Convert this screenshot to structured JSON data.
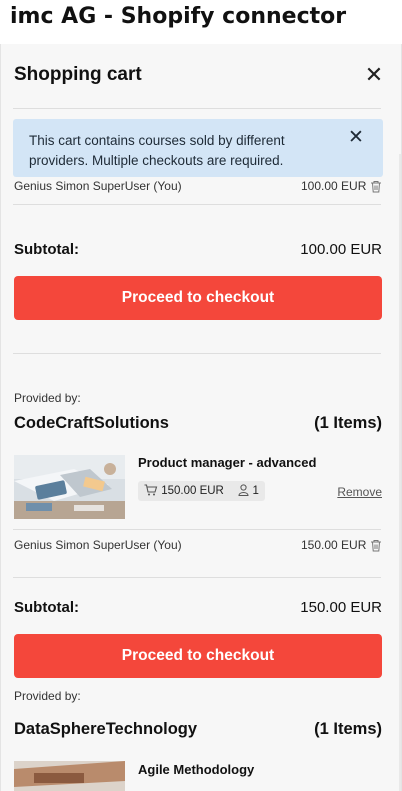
{
  "page_heading": "imc AG - Shopify connector",
  "cart": {
    "title": "Shopping cart",
    "close_icon": "close-icon",
    "notice": {
      "text": "This cart contains courses sold by different providers. Multiple checkouts are required.",
      "close_icon": "close-icon"
    },
    "first_group_partial": {
      "participant": "Genius Simon SuperUser (You)",
      "price": "100.00 EUR",
      "subtotal_label": "Subtotal:",
      "subtotal_value": "100.00 EUR",
      "checkout_label": "Proceed to checkout"
    },
    "groups": [
      {
        "provided_by": "Provided by:",
        "provider": "CodeCraftSolutions",
        "count": "(1 Items)",
        "item": {
          "title": "Product manager - advanced",
          "price": "150.00 EUR",
          "seats": "1",
          "remove_label": "Remove"
        },
        "participant": "Genius Simon SuperUser (You)",
        "participant_price": "150.00 EUR",
        "subtotal_label": "Subtotal:",
        "subtotal_value": "150.00 EUR",
        "checkout_label": "Proceed to checkout"
      },
      {
        "provided_by": "Provided by:",
        "provider": "DataSphereTechnology",
        "count": "(1 Items)",
        "item": {
          "title": "Agile Methodology"
        }
      }
    ]
  },
  "colors": {
    "checkout_button": "#f4473b",
    "notice_background": "#d3e5f6",
    "panel_background": "#f7f7f7"
  }
}
